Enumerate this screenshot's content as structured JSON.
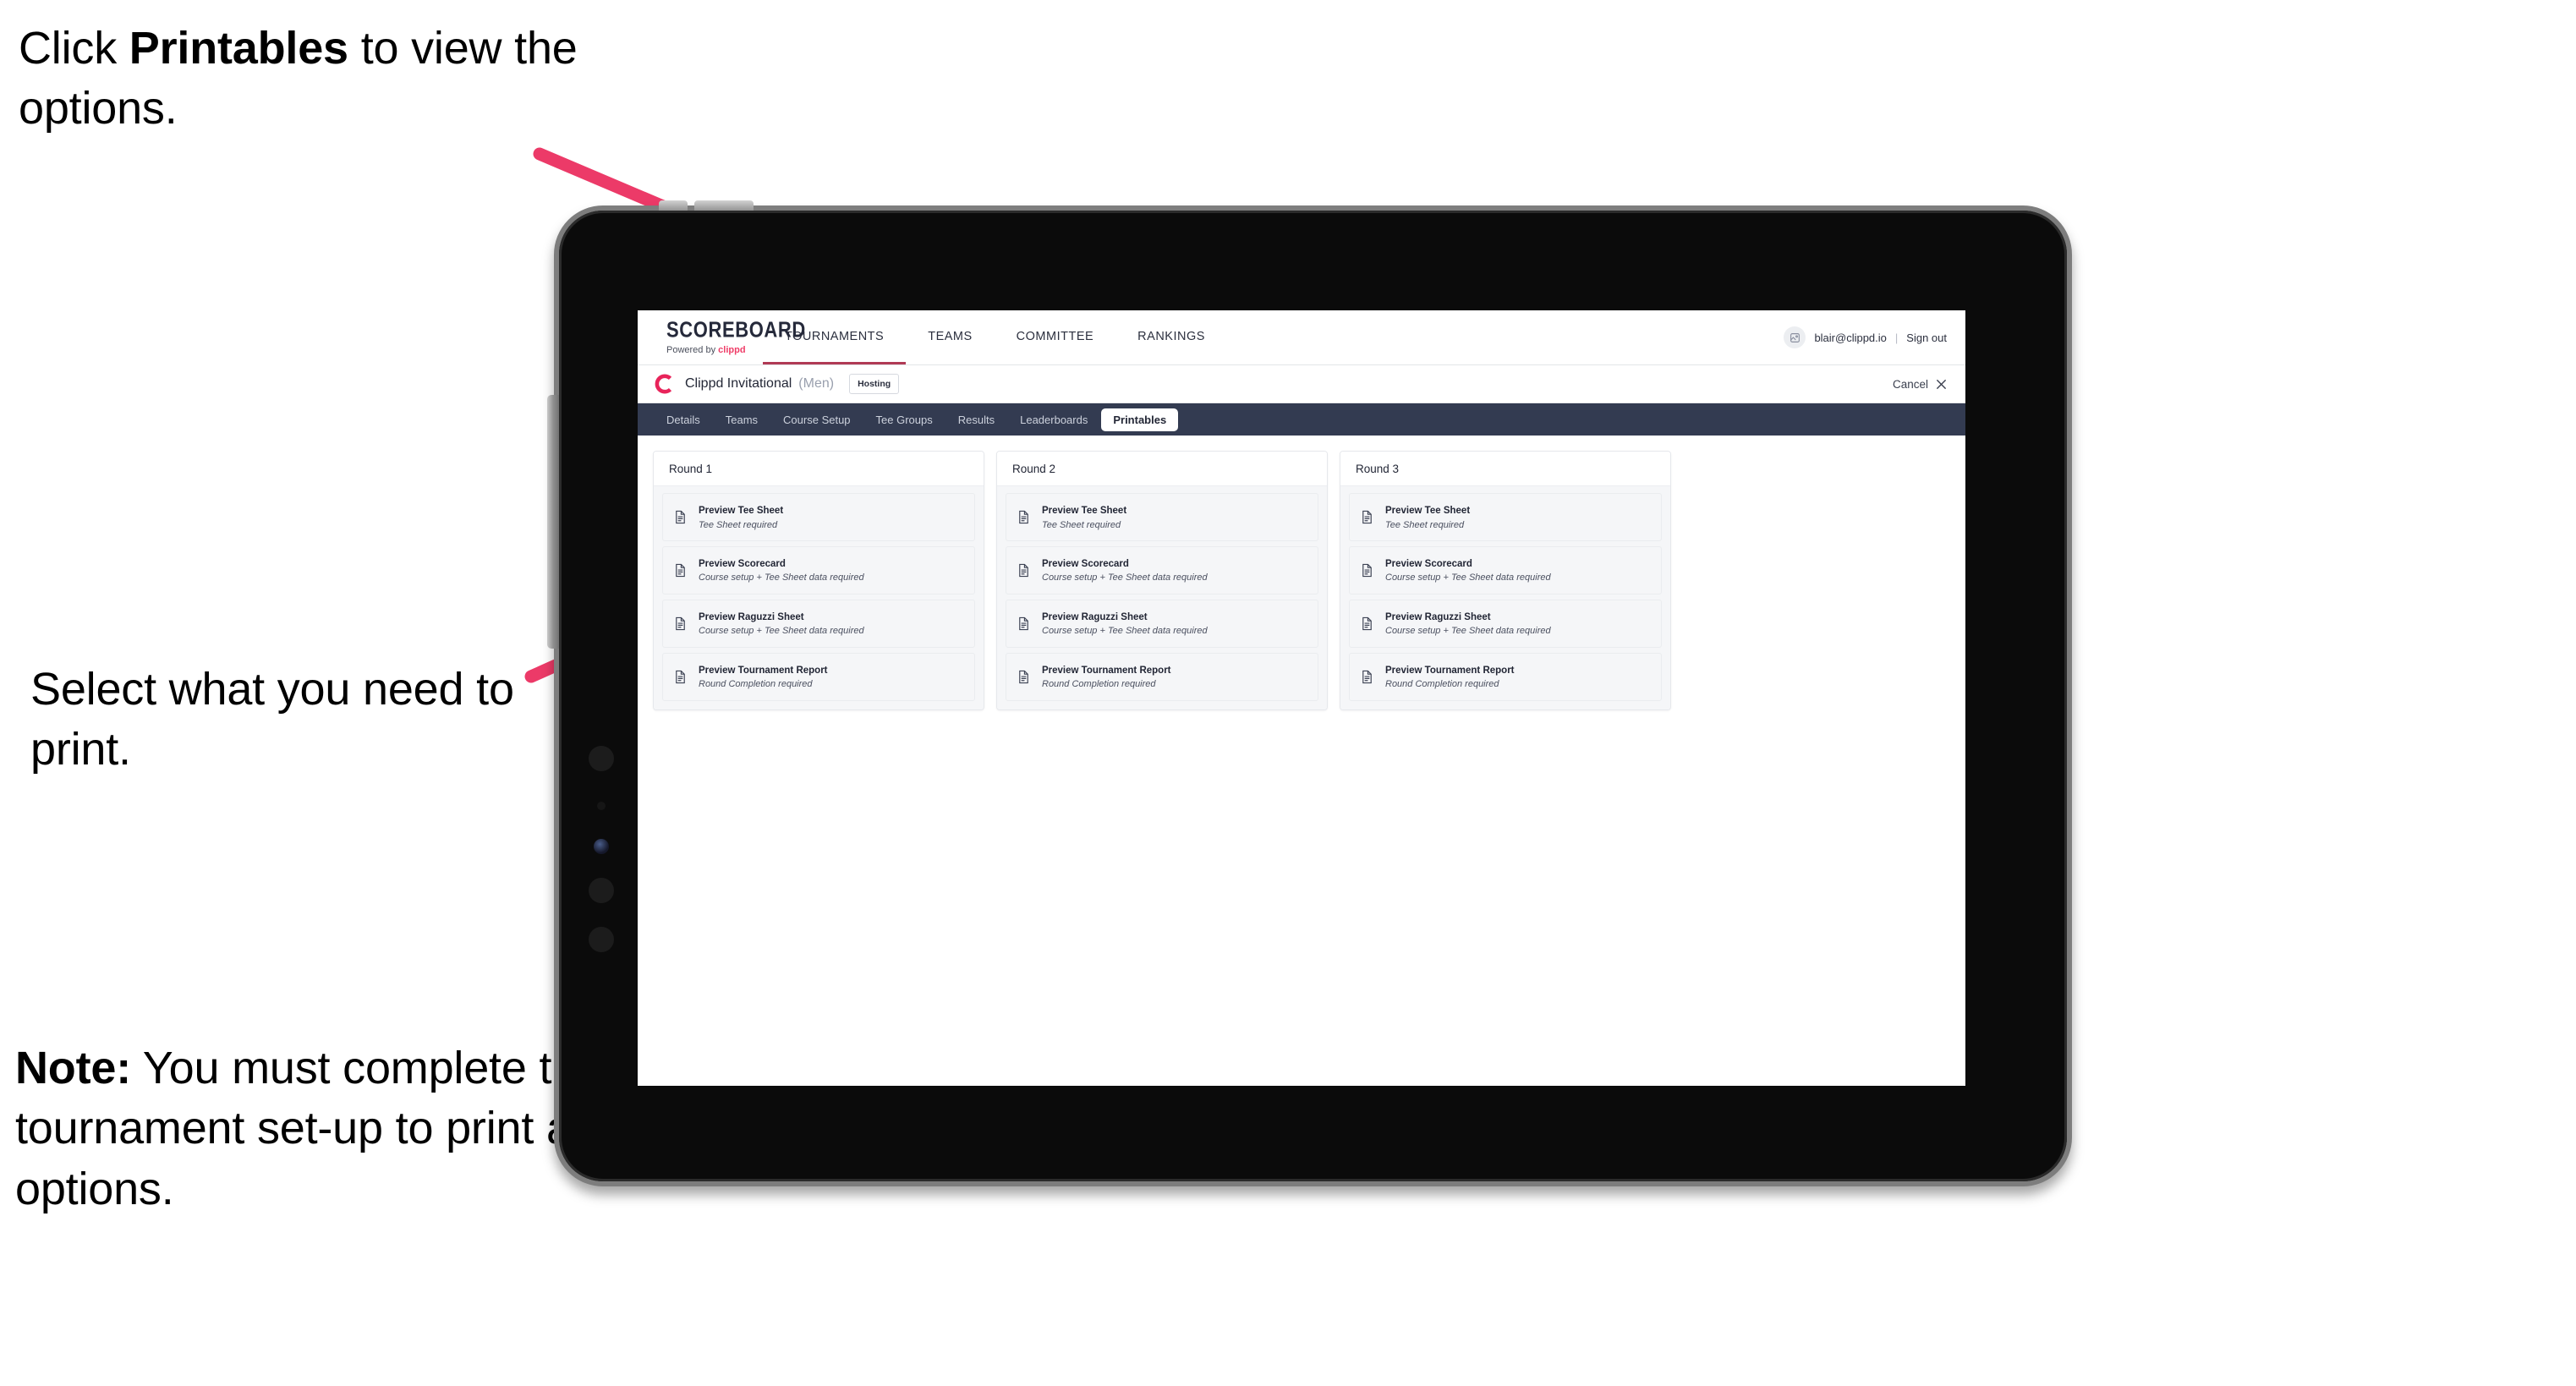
{
  "annotations": {
    "top": {
      "pre": "Click ",
      "bold": "Printables",
      "post": " to view the options."
    },
    "middle": {
      "text": "Select what you need to print."
    },
    "note": {
      "bold": "Note:",
      "post": " You must complete the tournament set-up to print all the options."
    }
  },
  "colors": {
    "arrow": "#ec3a68",
    "accent_pink": "#ef3d68",
    "subnav_bg": "#333b51",
    "text_dark": "#232736"
  },
  "app": {
    "topnav": {
      "brand_name": "SCOREBOARD",
      "brand_sub_prefix": "Powered by ",
      "brand_sub_accent": "clippd",
      "items": [
        {
          "label": "TOURNAMENTS",
          "active": true
        },
        {
          "label": "TEAMS",
          "active": false
        },
        {
          "label": "COMMITTEE",
          "active": false
        },
        {
          "label": "RANKINGS",
          "active": false
        }
      ],
      "avatar_icon": "user-avatar-icon",
      "user_email": "blair@clippd.io",
      "separator": "|",
      "sign_out": "Sign out"
    },
    "tournament_bar": {
      "logo_icon": "clippd-c-logo-icon",
      "name": "Clippd Invitational",
      "gender": "(Men)",
      "badge": "Hosting",
      "cancel_label": "Cancel",
      "cancel_icon": "close-x-icon"
    },
    "subtabs": [
      {
        "label": "Details",
        "active": false
      },
      {
        "label": "Teams",
        "active": false
      },
      {
        "label": "Course Setup",
        "active": false
      },
      {
        "label": "Tee Groups",
        "active": false
      },
      {
        "label": "Results",
        "active": false
      },
      {
        "label": "Leaderboards",
        "active": false
      },
      {
        "label": "Printables",
        "active": true
      }
    ],
    "rounds": [
      {
        "title": "Round 1",
        "documents": [
          {
            "title": "Preview Tee Sheet",
            "requirement": "Tee Sheet required",
            "icon": "document-icon"
          },
          {
            "title": "Preview Scorecard",
            "requirement": "Course setup + Tee Sheet data required",
            "icon": "document-icon"
          },
          {
            "title": "Preview Raguzzi Sheet",
            "requirement": "Course setup + Tee Sheet data required",
            "icon": "document-icon"
          },
          {
            "title": "Preview Tournament Report",
            "requirement": "Round Completion required",
            "icon": "document-icon"
          }
        ]
      },
      {
        "title": "Round 2",
        "documents": [
          {
            "title": "Preview Tee Sheet",
            "requirement": "Tee Sheet required",
            "icon": "document-icon"
          },
          {
            "title": "Preview Scorecard",
            "requirement": "Course setup + Tee Sheet data required",
            "icon": "document-icon"
          },
          {
            "title": "Preview Raguzzi Sheet",
            "requirement": "Course setup + Tee Sheet data required",
            "icon": "document-icon"
          },
          {
            "title": "Preview Tournament Report",
            "requirement": "Round Completion required",
            "icon": "document-icon"
          }
        ]
      },
      {
        "title": "Round 3",
        "documents": [
          {
            "title": "Preview Tee Sheet",
            "requirement": "Tee Sheet required",
            "icon": "document-icon"
          },
          {
            "title": "Preview Scorecard",
            "requirement": "Course setup + Tee Sheet data required",
            "icon": "document-icon"
          },
          {
            "title": "Preview Raguzzi Sheet",
            "requirement": "Course setup + Tee Sheet data required",
            "icon": "document-icon"
          },
          {
            "title": "Preview Tournament Report",
            "requirement": "Round Completion required",
            "icon": "document-icon"
          }
        ]
      }
    ]
  }
}
